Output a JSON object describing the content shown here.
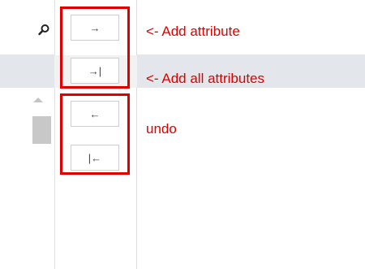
{
  "left_panel": {
    "search_icon": "search-icon"
  },
  "buttons": {
    "add_attribute": "→",
    "add_all_attributes": "→|",
    "remove_attribute": "←",
    "remove_all_attributes": "|←"
  },
  "annotations": {
    "add_attribute": "<- Add attribute",
    "add_all_attributes": "<- Add all attributes",
    "undo": "undo"
  },
  "colors": {
    "annotation": "#e00000",
    "highlight_row": "#e3e6ea"
  }
}
